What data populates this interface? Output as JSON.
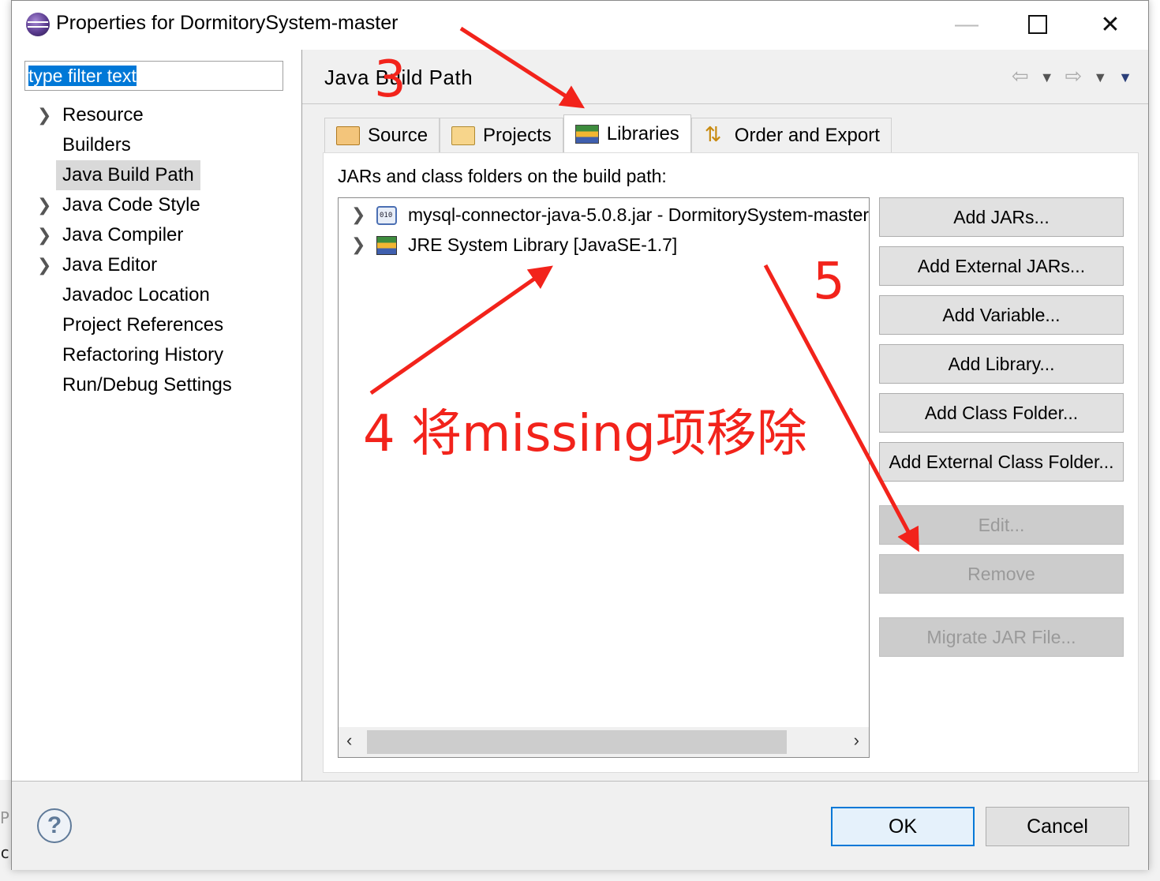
{
  "background": {
    "ghost_text_1": "Pr",
    "ghost_text_2": "c"
  },
  "window": {
    "title": "Properties for DormitorySystem-master",
    "minimize": "—",
    "close": "✕"
  },
  "filter": {
    "value": "type filter text"
  },
  "nav_tree": {
    "items": [
      {
        "label": "Resource",
        "expandable": true
      },
      {
        "label": "Builders",
        "expandable": false
      },
      {
        "label": "Java Build Path",
        "expandable": false,
        "selected": true
      },
      {
        "label": "Java Code Style",
        "expandable": true
      },
      {
        "label": "Java Compiler",
        "expandable": true
      },
      {
        "label": "Java Editor",
        "expandable": true
      },
      {
        "label": "Javadoc Location",
        "expandable": false
      },
      {
        "label": "Project References",
        "expandable": false
      },
      {
        "label": "Refactoring History",
        "expandable": false
      },
      {
        "label": "Run/Debug Settings",
        "expandable": false
      }
    ]
  },
  "page": {
    "title": "Java Build Path",
    "tabs": [
      {
        "label": "Source",
        "icon": "source-folder-icon"
      },
      {
        "label": "Projects",
        "icon": "projects-folder-icon"
      },
      {
        "label": "Libraries",
        "icon": "libraries-icon",
        "active": true
      },
      {
        "label": "Order and Export",
        "icon": "order-export-icon"
      }
    ],
    "list_label": "JARs and class folders on the build path:",
    "entries": [
      {
        "text": "mysql-connector-java-5.0.8.jar - DormitorySystem-master",
        "icon": "jar-file-icon"
      },
      {
        "text": "JRE System Library [JavaSE-1.7]",
        "icon": "jre-library-icon"
      }
    ],
    "buttons": {
      "add_jars": "Add JARs...",
      "add_external_jars": "Add External JARs...",
      "add_variable": "Add Variable...",
      "add_library": "Add Library...",
      "add_class_folder": "Add Class Folder...",
      "add_external_class_folder": "Add External Class Folder...",
      "edit": "Edit...",
      "remove": "Remove",
      "migrate_jar": "Migrate JAR File..."
    }
  },
  "footer": {
    "help": "?",
    "ok": "OK",
    "cancel": "Cancel"
  },
  "annotations": {
    "step3": "3",
    "step4": "4 将missing项移除",
    "step5": "5",
    "color": "#f2231b"
  }
}
